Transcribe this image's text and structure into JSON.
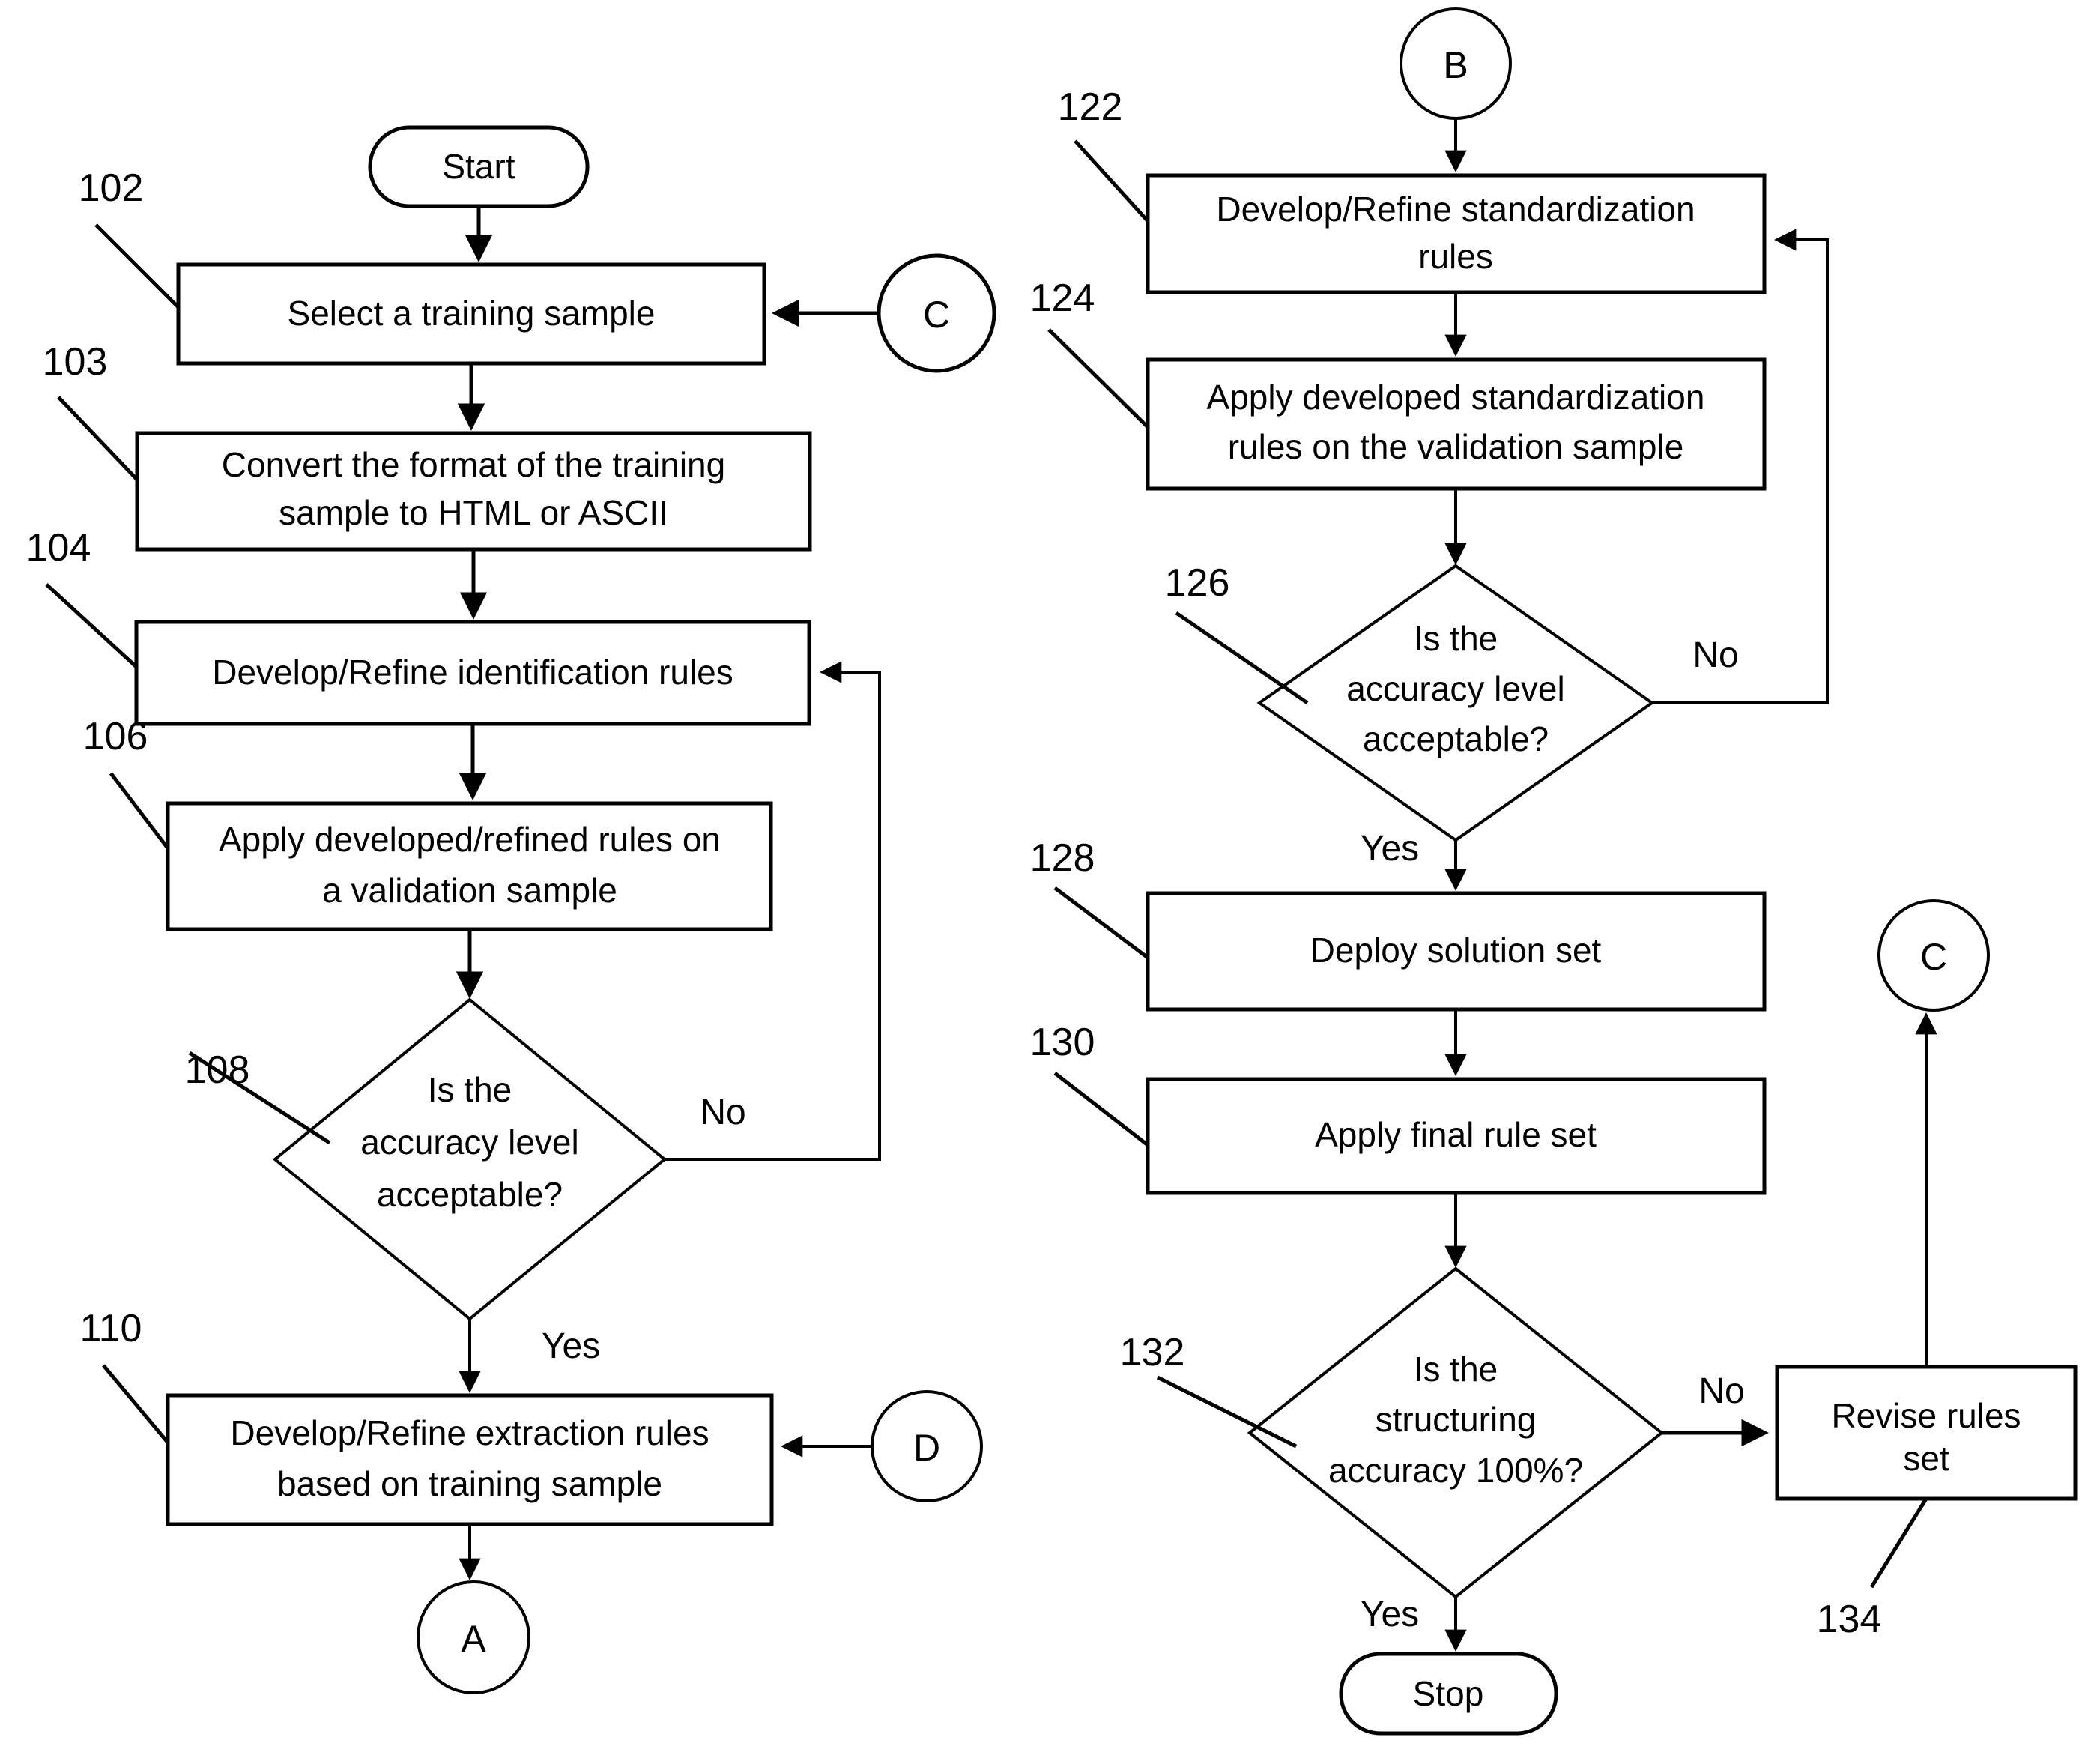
{
  "diagram": {
    "type": "flowchart",
    "title": "",
    "colors": {
      "stroke": "#000000",
      "fill": "#ffffff",
      "text": "#000000"
    },
    "left_column": {
      "start_terminator": "Start",
      "nodes": [
        {
          "ref": "102",
          "label": "Select a training sample"
        },
        {
          "ref": "103",
          "label_line1": "Convert the format of the training",
          "label_line2": "sample to HTML or ASCII"
        },
        {
          "ref": "104",
          "label": "Develop/Refine identification rules"
        },
        {
          "ref": "106",
          "label_line1": "Apply developed/refined rules on",
          "label_line2": "a validation sample"
        },
        {
          "ref": "108",
          "label_line1": "Is the",
          "label_line2": "accuracy level",
          "label_line3": "acceptable?"
        },
        {
          "ref": "110",
          "label_line1": "Develop/Refine extraction rules",
          "label_line2": "based on training sample"
        }
      ],
      "connector_in_c": "C",
      "connector_in_d": "D",
      "connector_out_a": "A",
      "edge_labels": {
        "no": "No",
        "yes": "Yes"
      }
    },
    "right_column": {
      "connector_in_b": "B",
      "nodes": [
        {
          "ref": "122",
          "label_line1": "Develop/Refine standardization",
          "label_line2": "rules"
        },
        {
          "ref": "124",
          "label_line1": "Apply developed standardization",
          "label_line2": "rules on the validation sample"
        },
        {
          "ref": "126",
          "label_line1": "Is the",
          "label_line2": "accuracy level",
          "label_line3": "acceptable?"
        },
        {
          "ref": "128",
          "label": "Deploy solution set"
        },
        {
          "ref": "130",
          "label": "Apply final rule set"
        },
        {
          "ref": "132",
          "label_line1": "Is the",
          "label_line2": "structuring",
          "label_line3": "accuracy 100%?"
        },
        {
          "ref": "134",
          "label_line1": "Revise rules",
          "label_line2": "set"
        }
      ],
      "connector_out_c": "C",
      "stop_terminator": "Stop",
      "edge_labels": {
        "no_126": "No",
        "yes_126": "Yes",
        "no_132": "No",
        "yes_132": "Yes"
      }
    }
  }
}
